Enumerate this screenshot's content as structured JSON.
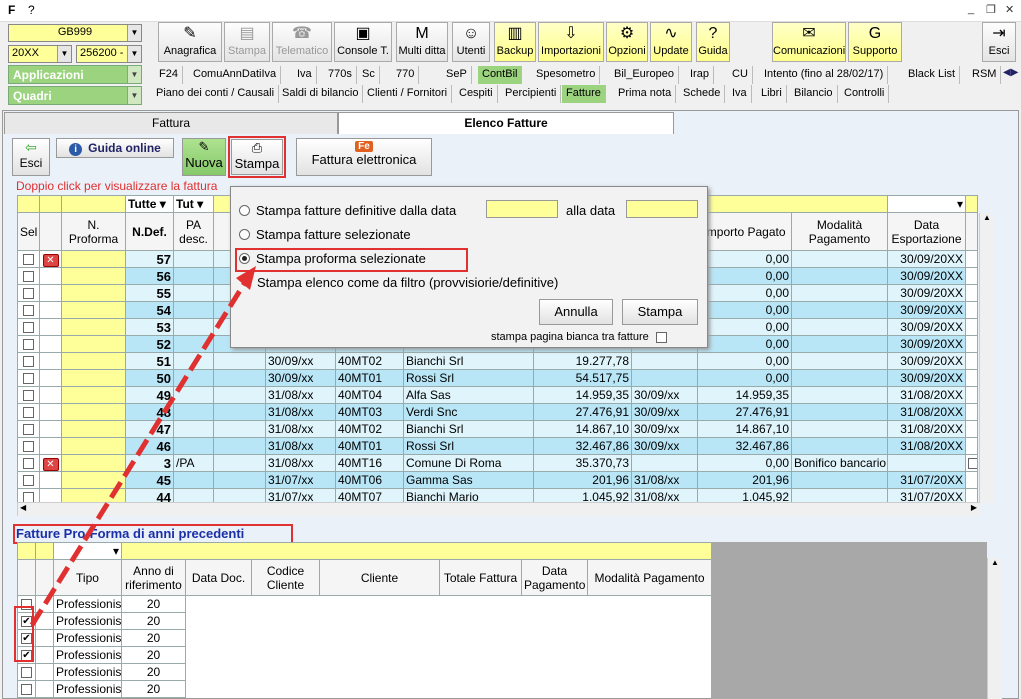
{
  "titlebar": {
    "logo": "F",
    "help": "?"
  },
  "controls": {
    "company": "GB999",
    "year": "20XX",
    "code": "256200 -",
    "applicazioni": "Applicazioni",
    "quadri": "Quadri"
  },
  "toolbar": [
    {
      "label": "Anagrafica",
      "icon": "✎",
      "name": "anagrafica-button"
    },
    {
      "label": "Stampa",
      "icon": "▤",
      "name": "stampa-toolbar-button"
    },
    {
      "label": "Telematico",
      "icon": "☎",
      "name": "telematico-button"
    },
    {
      "label": "Console T.",
      "icon": "▣",
      "name": "console-button"
    },
    {
      "label": "Multi ditta",
      "icon": "M",
      "name": "multi-ditta-button"
    },
    {
      "label": "Utenti",
      "icon": "☺",
      "name": "utenti-button"
    },
    {
      "label": "Backup",
      "icon": "▥",
      "name": "backup-button"
    },
    {
      "label": "Importazioni",
      "icon": "⇩",
      "name": "importazioni-button"
    },
    {
      "label": "Opzioni",
      "icon": "⚙",
      "name": "opzioni-button"
    },
    {
      "label": "Update",
      "icon": "∿",
      "name": "update-button"
    },
    {
      "label": "Guida",
      "icon": "?",
      "name": "guida-button"
    },
    {
      "label": "Comunicazioni",
      "icon": "✉",
      "name": "comunicazioni-button"
    },
    {
      "label": "Supporto",
      "icon": "G",
      "name": "supporto-button"
    },
    {
      "label": "Esci",
      "icon": "⇥",
      "name": "esci-top-button"
    }
  ],
  "tabs1": [
    "F24",
    "ComuAnnDatiIva",
    "Iva",
    "770s",
    "Sc",
    "770",
    "SeP",
    "ContBil",
    "Spesometro",
    "Bil_Europeo",
    "Irap",
    "CU",
    "Intento (fino al 28/02/17)",
    "Black List",
    "RSM"
  ],
  "tabs2": [
    "Piano dei conti / Causali",
    "Saldi di bilancio",
    "Clienti / Fornitori",
    "Cespiti",
    "Percipienti",
    "Fatture",
    "Prima nota",
    "Schede",
    "Iva",
    "Libri",
    "Bilancio",
    "Controlli"
  ],
  "main_tabs": {
    "fattura": "Fattura",
    "elenco": "Elenco Fatture"
  },
  "actions": {
    "esci": "Esci",
    "guida": "Guida online",
    "nuova": "Nuova",
    "stampa": "Stampa",
    "fattura_elettronica": "Fattura elettronica"
  },
  "hint": "Doppio click per visualizzare la fattura",
  "grid": {
    "filters": {
      "tutte": "Tutte",
      "tut": "Tut"
    },
    "headers": {
      "sel": "Sel",
      "proforma": "N. Proforma",
      "ndef": "N.Def.",
      "pa": "PA desc.",
      "pagato": "Importo Pagato",
      "modalita": "Modalità Pagamento",
      "export": "Data Esportazione"
    },
    "rows": [
      {
        "n": "57",
        "pa": "",
        "date": "",
        "code": "",
        "cli": "",
        "tot": "",
        "dpag": "",
        "pag": "0,00",
        "mod": "",
        "exp": "30/09/20XX",
        "x": true
      },
      {
        "n": "56",
        "pa": "",
        "date": "",
        "code": "",
        "cli": "",
        "tot": "",
        "dpag": "",
        "pag": "0,00",
        "mod": "",
        "exp": "30/09/20XX",
        "x": false
      },
      {
        "n": "55",
        "pa": "",
        "date": "",
        "code": "",
        "cli": "",
        "tot": "",
        "dpag": "",
        "pag": "0,00",
        "mod": "",
        "exp": "30/09/20XX",
        "x": false
      },
      {
        "n": "54",
        "pa": "",
        "date": "",
        "code": "",
        "cli": "",
        "tot": "",
        "dpag": "",
        "pag": "0,00",
        "mod": "",
        "exp": "30/09/20XX",
        "x": false
      },
      {
        "n": "53",
        "pa": "",
        "date": "",
        "code": "",
        "cli": "",
        "tot": "",
        "dpag": "",
        "pag": "0,00",
        "mod": "",
        "exp": "30/09/20XX",
        "x": false
      },
      {
        "n": "52",
        "pa": "",
        "date": "",
        "code": "",
        "cli": "",
        "tot": "",
        "dpag": "",
        "pag": "0,00",
        "mod": "",
        "exp": "30/09/20XX",
        "x": false
      },
      {
        "n": "51",
        "pa": "",
        "date": "30/09/xx",
        "code": "40MT02",
        "cli": "Bianchi Srl",
        "tot": "19.277,78",
        "dpag": "",
        "pag": "0,00",
        "mod": "",
        "exp": "30/09/20XX",
        "x": false
      },
      {
        "n": "50",
        "pa": "",
        "date": "30/09/xx",
        "code": "40MT01",
        "cli": "Rossi Srl",
        "tot": "54.517,75",
        "dpag": "",
        "pag": "0,00",
        "mod": "",
        "exp": "30/09/20XX",
        "x": false
      },
      {
        "n": "49",
        "pa": "",
        "date": "31/08/xx",
        "code": "40MT04",
        "cli": "Alfa Sas",
        "tot": "14.959,35",
        "dpag": "30/09/xx",
        "pag": "14.959,35",
        "mod": "",
        "exp": "31/08/20XX",
        "x": false
      },
      {
        "n": "48",
        "pa": "",
        "date": "31/08/xx",
        "code": "40MT03",
        "cli": "Verdi Snc",
        "tot": "27.476,91",
        "dpag": "30/09/xx",
        "pag": "27.476,91",
        "mod": "",
        "exp": "31/08/20XX",
        "x": false
      },
      {
        "n": "47",
        "pa": "",
        "date": "31/08/xx",
        "code": "40MT02",
        "cli": "Bianchi Srl",
        "tot": "14.867,10",
        "dpag": "30/09/xx",
        "pag": "14.867,10",
        "mod": "",
        "exp": "31/08/20XX",
        "x": false
      },
      {
        "n": "46",
        "pa": "",
        "date": "31/08/xx",
        "code": "40MT01",
        "cli": "Rossi Srl",
        "tot": "32.467,86",
        "dpag": "30/09/xx",
        "pag": "32.467,86",
        "mod": "",
        "exp": "31/08/20XX",
        "x": false
      },
      {
        "n": "3",
        "pa": "/PA",
        "date": "31/08/xx",
        "code": "40MT16",
        "cli": "Comune Di Roma",
        "tot": "35.370,73",
        "dpag": "",
        "pag": "0,00",
        "mod": "Bonifico bancario",
        "exp": "",
        "x": true
      },
      {
        "n": "45",
        "pa": "",
        "date": "31/07/xx",
        "code": "40MT06",
        "cli": "Gamma Sas",
        "tot": "201,96",
        "dpag": "31/08/xx",
        "pag": "201,96",
        "mod": "",
        "exp": "31/07/20XX",
        "x": false
      },
      {
        "n": "44",
        "pa": "",
        "date": "31/07/xx",
        "code": "40MT07",
        "cli": "Bianchi Mario",
        "tot": "1.045,92",
        "dpag": "31/08/xx",
        "pag": "1.045,92",
        "mod": "",
        "exp": "31/07/20XX",
        "x": false
      }
    ]
  },
  "dialog": {
    "opt1": "Stampa fatture definitive dalla data",
    "alla": "alla data",
    "opt2": "Stampa fatture selezionate",
    "opt3": "Stampa proforma selezionate",
    "opt4": "Stampa elenco come da filtro (provvisiorie/definitive)",
    "annulla": "Annulla",
    "stampa": "Stampa",
    "blank": "stampa pagina bianca tra fatture"
  },
  "proforma": {
    "title": "Fatture Pro-Forma di anni precedenti",
    "headers": {
      "tipo": "Tipo",
      "anno": "Anno di riferimento",
      "data": "Data Doc.",
      "codice": "Codice Cliente",
      "cliente": "Cliente",
      "totale": "Totale Fattura",
      "dpag": "Data Pagamento",
      "mod": "Modalità Pagamento"
    },
    "rows": [
      {
        "tipo": "Professionis",
        "anno": "20",
        "checked": false
      },
      {
        "tipo": "Professionis",
        "anno": "20",
        "checked": true
      },
      {
        "tipo": "Professionis",
        "anno": "20",
        "checked": true
      },
      {
        "tipo": "Professionis",
        "anno": "20",
        "checked": true
      },
      {
        "tipo": "Professionis",
        "anno": "20",
        "checked": false
      },
      {
        "tipo": "Professionis",
        "anno": "20",
        "checked": false
      }
    ]
  }
}
